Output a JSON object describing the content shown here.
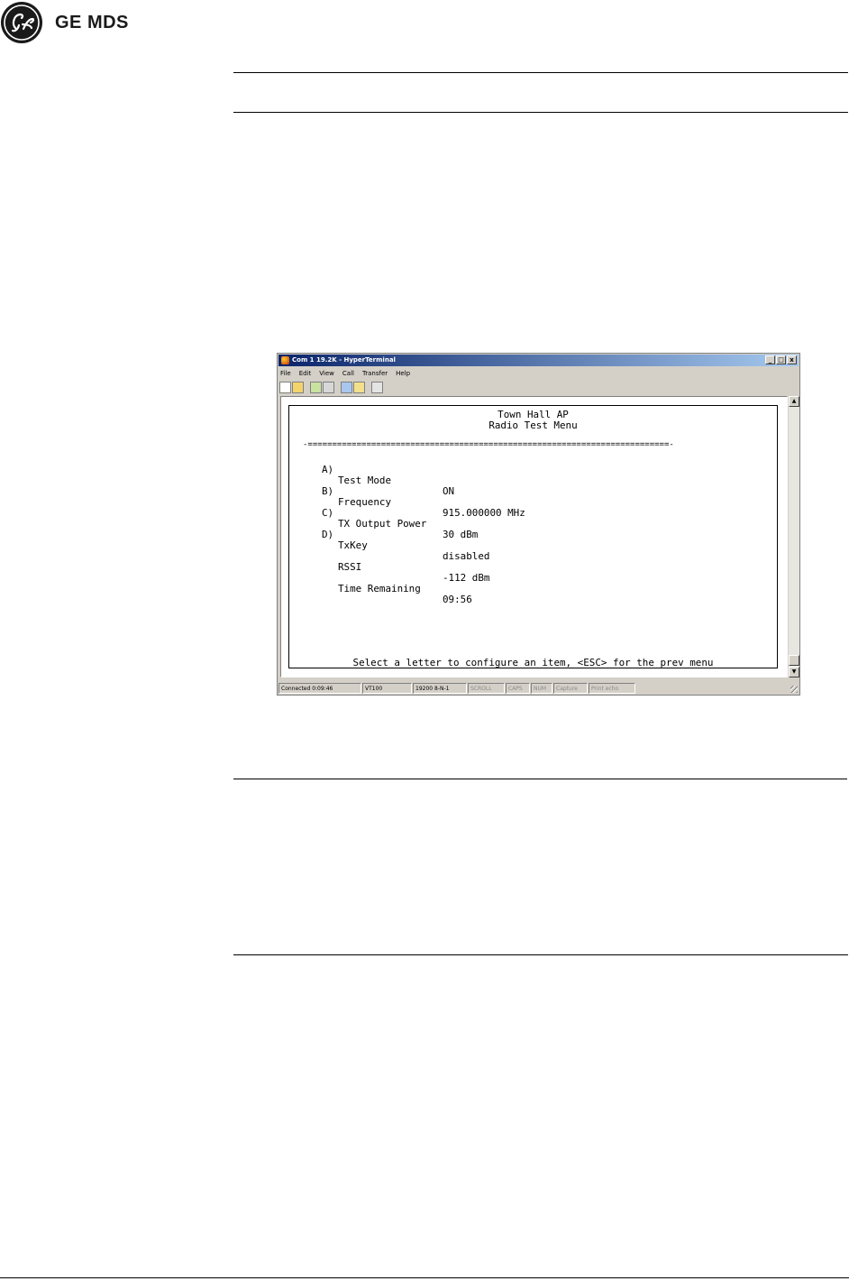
{
  "brand": {
    "name": "GE MDS"
  },
  "window": {
    "title": "Com 1 19.2K - HyperTerminal",
    "buttons": {
      "minimize": "_",
      "maximize": "□",
      "close": "x"
    },
    "menu": [
      "File",
      "Edit",
      "View",
      "Call",
      "Transfer",
      "Help"
    ],
    "toolbar": [
      "new-connection",
      "open",
      "call",
      "disconnect",
      "send",
      "receive",
      "properties"
    ]
  },
  "terminal": {
    "header_line1": "Town Hall AP",
    "header_line2": "Radio Test Menu",
    "separator": "-==========================================================================-",
    "items": [
      {
        "key": "A)",
        "label": "Test Mode",
        "value": "ON"
      },
      {
        "key": "B)",
        "label": "Frequency",
        "value": "915.000000 MHz"
      },
      {
        "key": "C)",
        "label": "TX Output Power",
        "value": "30 dBm"
      },
      {
        "key": "D)",
        "label": "TxKey",
        "value": "disabled"
      },
      {
        "key": "",
        "label": "RSSI",
        "value": "-112 dBm"
      },
      {
        "key": "",
        "label": "Time Remaining",
        "value": "09:56"
      }
    ],
    "prompt": "Select a letter to configure an item, <ESC> for the prev menu"
  },
  "status": {
    "connected": "Connected 0:09:46",
    "emulation": "VT100",
    "settings": "19200 8-N-1",
    "scroll": "SCROLL",
    "caps": "CAPS",
    "num": "NUM",
    "capture": "Capture",
    "print": "Print echo"
  }
}
